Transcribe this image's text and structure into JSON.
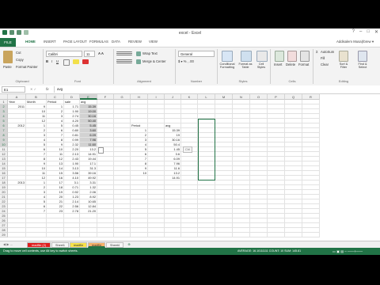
{
  "window": {
    "title": "excel - Excel",
    "controls": [
      "?",
      "–",
      "□",
      "✕"
    ]
  },
  "ribbon_tabs": [
    "FILE",
    "HOME",
    "INSERT",
    "PAGE LAYOUT",
    "FORMULAS",
    "DATA",
    "REVIEW",
    "VIEW"
  ],
  "user": "Addisalem Musa(Ibrew ▾",
  "ribbon": {
    "clipboard": {
      "paste": "Paste",
      "cut": "Cut",
      "copy": "Copy",
      "format_painter": "Format Painter",
      "group": "Clipboard"
    },
    "font": {
      "name": "Calibri",
      "size": "11",
      "group": "Font"
    },
    "alignment": {
      "wrap": "Wrap Text",
      "merge": "Merge & Center",
      "group": "Alignment"
    },
    "number": {
      "format": "General",
      "group": "Number"
    },
    "styles": {
      "conditional": "Conditional Formatting",
      "format_table": "Format as Table",
      "cell_styles": "Cell Styles",
      "group": "Styles"
    },
    "cells": {
      "insert": "Insert",
      "delete": "Delete",
      "format": "Format",
      "group": "Cells"
    },
    "editing": {
      "autosum": "AutoSum",
      "fill": "Fill",
      "clear": "Clear",
      "sort": "Sort & Filter",
      "find": "Find & Select",
      "group": "Editing"
    }
  },
  "formula_bar": {
    "name_box": "E1",
    "fx": "fx",
    "value": "avg"
  },
  "columns": [
    "A",
    "B",
    "C",
    "D",
    "E",
    "F",
    "G",
    "H",
    "I",
    "J",
    "K",
    "L",
    "M",
    "N",
    "O",
    "P",
    "Q",
    "R"
  ],
  "rows": [
    "1",
    "2",
    "3",
    "4",
    "5",
    "6",
    "7",
    "8",
    "9",
    "10",
    "11",
    "12",
    "13",
    "14",
    "15",
    "16",
    "17",
    "18",
    "19",
    "20",
    "21",
    "22",
    "23",
    "24",
    "25",
    "26",
    "27",
    "28",
    "29"
  ],
  "sheet_cells": [
    {
      "c": "A",
      "r": 1,
      "v": "Year"
    },
    {
      "c": "B",
      "r": 1,
      "v": "Month"
    },
    {
      "c": "C",
      "r": 1,
      "v": "Period"
    },
    {
      "c": "D",
      "r": 1,
      "v": "sale"
    },
    {
      "c": "E",
      "r": 1,
      "v": "avg"
    },
    {
      "c": "A",
      "r": 2,
      "v": "2011",
      "num": true
    },
    {
      "c": "B",
      "r": 2,
      "v": "9",
      "num": true
    },
    {
      "c": "C",
      "r": 2,
      "v": "1",
      "num": true
    },
    {
      "c": "D",
      "r": 2,
      "v": "1.71",
      "num": true
    },
    {
      "c": "E",
      "r": 2,
      "v": "15.39",
      "num": true
    },
    {
      "c": "B",
      "r": 3,
      "v": "10",
      "num": true
    },
    {
      "c": "C",
      "r": 3,
      "v": "2",
      "num": true
    },
    {
      "c": "D",
      "r": 3,
      "v": "1.90",
      "num": true
    },
    {
      "c": "E",
      "r": 3,
      "v": "19.00",
      "num": true
    },
    {
      "c": "B",
      "r": 4,
      "v": "11",
      "num": true
    },
    {
      "c": "C",
      "r": 4,
      "v": "3",
      "num": true
    },
    {
      "c": "D",
      "r": 4,
      "v": "2.74",
      "num": true
    },
    {
      "c": "E",
      "r": 4,
      "v": "30.16",
      "num": true
    },
    {
      "c": "B",
      "r": 5,
      "v": "12",
      "num": true
    },
    {
      "c": "C",
      "r": 5,
      "v": "4",
      "num": true
    },
    {
      "c": "D",
      "r": 5,
      "v": "4.20",
      "num": true
    },
    {
      "c": "E",
      "r": 5,
      "v": "50.40",
      "num": true
    },
    {
      "c": "A",
      "r": 6,
      "v": "2012",
      "num": true
    },
    {
      "c": "B",
      "r": 6,
      "v": "1",
      "num": true
    },
    {
      "c": "C",
      "r": 6,
      "v": "5",
      "num": true
    },
    {
      "c": "D",
      "r": 6,
      "v": "0.45",
      "num": true
    },
    {
      "c": "E",
      "r": 6,
      "v": "5.45",
      "num": true
    },
    {
      "c": "B",
      "r": 7,
      "v": "2",
      "num": true
    },
    {
      "c": "C",
      "r": 7,
      "v": "6",
      "num": true
    },
    {
      "c": "D",
      "r": 7,
      "v": "0.80",
      "num": true
    },
    {
      "c": "E",
      "r": 7,
      "v": "3.60",
      "num": true
    },
    {
      "c": "B",
      "r": 8,
      "v": "3",
      "num": true
    },
    {
      "c": "C",
      "r": 8,
      "v": "7",
      "num": true
    },
    {
      "c": "D",
      "r": 8,
      "v": "0.81",
      "num": true
    },
    {
      "c": "E",
      "r": 8,
      "v": "6.09",
      "num": true
    },
    {
      "c": "B",
      "r": 9,
      "v": "4",
      "num": true
    },
    {
      "c": "C",
      "r": 9,
      "v": "8",
      "num": true
    },
    {
      "c": "D",
      "r": 9,
      "v": "0.99",
      "num": true
    },
    {
      "c": "E",
      "r": 9,
      "v": "7.96",
      "num": true
    },
    {
      "c": "B",
      "r": 10,
      "v": "5",
      "num": true
    },
    {
      "c": "C",
      "r": 10,
      "v": "9",
      "num": true
    },
    {
      "c": "D",
      "r": 10,
      "v": "2.32",
      "num": true
    },
    {
      "c": "E",
      "r": 10,
      "v": "11.60",
      "num": true
    },
    {
      "c": "B",
      "r": 11,
      "v": "6",
      "num": true
    },
    {
      "c": "C",
      "r": 11,
      "v": "10",
      "num": true
    },
    {
      "c": "D",
      "r": 11,
      "v": "2.20",
      "num": true
    },
    {
      "c": "E",
      "r": 11,
      "v": "13.2",
      "num": true
    },
    {
      "c": "B",
      "r": 12,
      "v": "7",
      "num": true
    },
    {
      "c": "C",
      "r": 12,
      "v": "11",
      "num": true
    },
    {
      "c": "D",
      "r": 12,
      "v": "2.13",
      "num": true
    },
    {
      "c": "E",
      "r": 12,
      "v": "14.91",
      "num": true
    },
    {
      "c": "B",
      "r": 13,
      "v": "8",
      "num": true
    },
    {
      "c": "C",
      "r": 13,
      "v": "12",
      "num": true
    },
    {
      "c": "D",
      "r": 13,
      "v": "2.43",
      "num": true
    },
    {
      "c": "E",
      "r": 13,
      "v": "19.44",
      "num": true
    },
    {
      "c": "B",
      "r": 14,
      "v": "9",
      "num": true
    },
    {
      "c": "C",
      "r": 14,
      "v": "13",
      "num": true
    },
    {
      "c": "D",
      "r": 14,
      "v": "1.90",
      "num": true
    },
    {
      "c": "E",
      "r": 14,
      "v": "17.1",
      "num": true
    },
    {
      "c": "B",
      "r": 15,
      "v": "10",
      "num": true
    },
    {
      "c": "C",
      "r": 15,
      "v": "14",
      "num": true
    },
    {
      "c": "D",
      "r": 15,
      "v": "3.13",
      "num": true
    },
    {
      "c": "E",
      "r": 15,
      "v": "31.3",
      "num": true
    },
    {
      "c": "B",
      "r": 16,
      "v": "11",
      "num": true
    },
    {
      "c": "C",
      "r": 16,
      "v": "15",
      "num": true
    },
    {
      "c": "D",
      "r": 16,
      "v": "3.56",
      "num": true
    },
    {
      "c": "E",
      "r": 16,
      "v": "39.16",
      "num": true
    },
    {
      "c": "B",
      "r": 17,
      "v": "12",
      "num": true
    },
    {
      "c": "C",
      "r": 17,
      "v": "16",
      "num": true
    },
    {
      "c": "D",
      "r": 17,
      "v": "4.10",
      "num": true
    },
    {
      "c": "E",
      "r": 17,
      "v": "49.92",
      "num": true
    },
    {
      "c": "A",
      "r": 18,
      "v": "2013",
      "num": true
    },
    {
      "c": "B",
      "r": 18,
      "v": "1",
      "num": true
    },
    {
      "c": "C",
      "r": 18,
      "v": "17",
      "num": true
    },
    {
      "c": "D",
      "r": 18,
      "v": "3.1",
      "num": true
    },
    {
      "c": "E",
      "r": 18,
      "v": "3.31",
      "num": true
    },
    {
      "c": "B",
      "r": 19,
      "v": "2",
      "num": true
    },
    {
      "c": "C",
      "r": 19,
      "v": "18",
      "num": true
    },
    {
      "c": "D",
      "r": 19,
      "v": "0.71",
      "num": true
    },
    {
      "c": "E",
      "r": 19,
      "v": "1.32",
      "num": true
    },
    {
      "c": "B",
      "r": 20,
      "v": "3",
      "num": true
    },
    {
      "c": "C",
      "r": 20,
      "v": "19",
      "num": true
    },
    {
      "c": "D",
      "r": 20,
      "v": "0.92",
      "num": true
    },
    {
      "c": "E",
      "r": 20,
      "v": "2.06",
      "num": true
    },
    {
      "c": "B",
      "r": 21,
      "v": "4",
      "num": true
    },
    {
      "c": "C",
      "r": 21,
      "v": "20",
      "num": true
    },
    {
      "c": "D",
      "r": 21,
      "v": "1.23",
      "num": true
    },
    {
      "c": "E",
      "r": 21,
      "v": "8.92",
      "num": true
    },
    {
      "c": "B",
      "r": 22,
      "v": "5",
      "num": true
    },
    {
      "c": "C",
      "r": 22,
      "v": "21",
      "num": true
    },
    {
      "c": "D",
      "r": 22,
      "v": "2.14",
      "num": true
    },
    {
      "c": "E",
      "r": 22,
      "v": "10.65",
      "num": true
    },
    {
      "c": "B",
      "r": 23,
      "v": "6",
      "num": true
    },
    {
      "c": "C",
      "r": 23,
      "v": "22",
      "num": true
    },
    {
      "c": "D",
      "r": 23,
      "v": "2.56",
      "num": true
    },
    {
      "c": "E",
      "r": 23,
      "v": "12.84",
      "num": true
    },
    {
      "c": "B",
      "r": 24,
      "v": "7",
      "num": true
    },
    {
      "c": "C",
      "r": 24,
      "v": "23",
      "num": true
    },
    {
      "c": "D",
      "r": 24,
      "v": "2.78",
      "num": true
    },
    {
      "c": "E",
      "r": 24,
      "v": "21.20",
      "num": true
    },
    {
      "c": "H",
      "r": 6,
      "v": "Period"
    },
    {
      "c": "J",
      "r": 6,
      "v": "avg"
    },
    {
      "c": "H",
      "r": 7,
      "v": "1",
      "num": true
    },
    {
      "c": "J",
      "r": 7,
      "v": "15.39",
      "num": true
    },
    {
      "c": "H",
      "r": 8,
      "v": "2",
      "num": true
    },
    {
      "c": "J",
      "r": 8,
      "v": "19",
      "num": true
    },
    {
      "c": "H",
      "r": 9,
      "v": "3",
      "num": true
    },
    {
      "c": "J",
      "r": 9,
      "v": "30.16",
      "num": true
    },
    {
      "c": "H",
      "r": 10,
      "v": "4",
      "num": true
    },
    {
      "c": "J",
      "r": 10,
      "v": "50.4",
      "num": true
    },
    {
      "c": "H",
      "r": 11,
      "v": "5",
      "num": true
    },
    {
      "c": "J",
      "r": 11,
      "v": "1.45",
      "num": true
    },
    {
      "c": "H",
      "r": 12,
      "v": "6",
      "num": true
    },
    {
      "c": "J",
      "r": 12,
      "v": "3.6",
      "num": true
    },
    {
      "c": "H",
      "r": 13,
      "v": "7",
      "num": true
    },
    {
      "c": "J",
      "r": 13,
      "v": "6.09",
      "num": true
    },
    {
      "c": "H",
      "r": 14,
      "v": "8",
      "num": true
    },
    {
      "c": "J",
      "r": 14,
      "v": "7.96",
      "num": true
    },
    {
      "c": "H",
      "r": 15,
      "v": "9",
      "num": true
    },
    {
      "c": "J",
      "r": 15,
      "v": "11.6",
      "num": true
    },
    {
      "c": "H",
      "r": 16,
      "v": "10",
      "num": true
    },
    {
      "c": "J",
      "r": 16,
      "v": "13.2",
      "num": true
    },
    {
      "c": "J",
      "r": 17,
      "v": "14.91",
      "num": true
    }
  ],
  "paste_tooltip": "Ctrl",
  "sheet_tabs": [
    {
      "label": "readfile (2)",
      "style": "red"
    },
    {
      "label": "Sheet1",
      "style": "plain"
    },
    {
      "label": "readfile",
      "style": "yellow"
    },
    {
      "label": "readfile",
      "style": "orange-active"
    },
    {
      "label": "Sheet4",
      "style": "plain"
    }
  ],
  "status": {
    "message": "Drag to move cell contents, use Alt key to switch sheets.",
    "stats": "AVERAGE: 16.10111111   COUNT: 10   SUM: 145.81"
  }
}
